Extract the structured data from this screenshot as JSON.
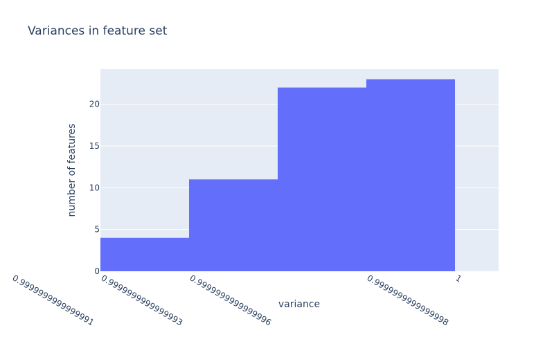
{
  "chart_data": {
    "type": "bar",
    "title": "Variances in feature set",
    "xlabel": "variance",
    "ylabel": "number of features",
    "categories": [
      "0.9999999999999991",
      "0.9999999999999993",
      "0.9999999999999996",
      "0.9999999999999998"
    ],
    "x_bins": [
      {
        "start": 0.9999999999999993,
        "end": 0.9999999999999994,
        "count": 4
      },
      {
        "start": 0.9999999999999994,
        "end": 0.9999999999999996,
        "count": 11
      },
      {
        "start": 0.9999999999999996,
        "end": 0.9999999999999997,
        "count": 22
      },
      {
        "start": 0.9999999999999997,
        "end": 0.9999999999999999,
        "count": 23
      }
    ],
    "values": [
      4,
      11,
      22,
      23
    ],
    "x_tick_labels": [
      "0.9999999999999991",
      "0.9999999999999993",
      "0.9999999999999996",
      "0.9999999999999998",
      "1"
    ],
    "y_ticks": [
      0,
      5,
      10,
      15,
      20
    ],
    "ylim": [
      0,
      24.2
    ],
    "grid": true,
    "colors": {
      "bar": "#636efa",
      "plot_bg": "#e5ecf6",
      "grid": "#ffffff",
      "text": "#2a3f5f"
    }
  }
}
